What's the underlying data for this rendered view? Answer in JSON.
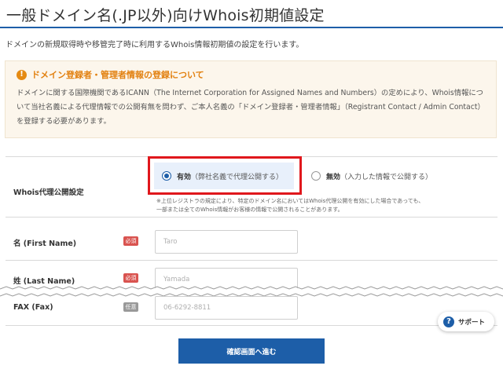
{
  "header": {
    "title": "一般ドメイン名(.JP以外)向けWhois初期値設定",
    "intro": "ドメインの新規取得時や移管完了時に利用するWhois情報初期値の設定を行います。"
  },
  "notice": {
    "icon": "warning-icon",
    "title": "ドメイン登録者・管理者情報の登録について",
    "body": "ドメインに関する国際機関であるICANN（The Internet Corporation for Assigned Names and Numbers）の定めにより、Whois情報について当社名義による代理情報での公開有無を問わず、ご本人名義の「ドメイン登録者・管理者情報」（Registrant Contact / Admin Contact）を登録する必要があります。"
  },
  "form": {
    "whois_proxy": {
      "label": "Whois代理公開設定",
      "options": [
        {
          "strong": "有効",
          "detail": "（弊社名義で代理公開する）",
          "selected": true
        },
        {
          "strong": "無効",
          "detail": "（入力した情報で公開する）",
          "selected": false
        }
      ],
      "note_line1": "※上位レジストラの規定により、特定のドメイン名においてはWhois代理公開を有効にした場合であっても、",
      "note_line2": "一部または全てのWhois情報がお客様の情報で公開されることがあります。"
    },
    "first_name": {
      "label": "名 (First Name)",
      "badge": "必須",
      "value": "",
      "placeholder": "Taro"
    },
    "last_name": {
      "label": "姓 (Last Name)",
      "badge": "必須",
      "value": "",
      "placeholder": "Yamada"
    },
    "fax": {
      "label": "FAX (Fax)",
      "badge": "任意",
      "value": "",
      "placeholder": "06-6292-8811"
    }
  },
  "support": {
    "icon": "question-icon",
    "label": "サポート"
  },
  "submit": {
    "label": "確認画面へ進む"
  },
  "colors": {
    "accent": "#1d5ea8",
    "warning": "#e2800f",
    "highlight": "#e0171c",
    "required_badge": "#d9534f",
    "optional_badge": "#999999"
  }
}
